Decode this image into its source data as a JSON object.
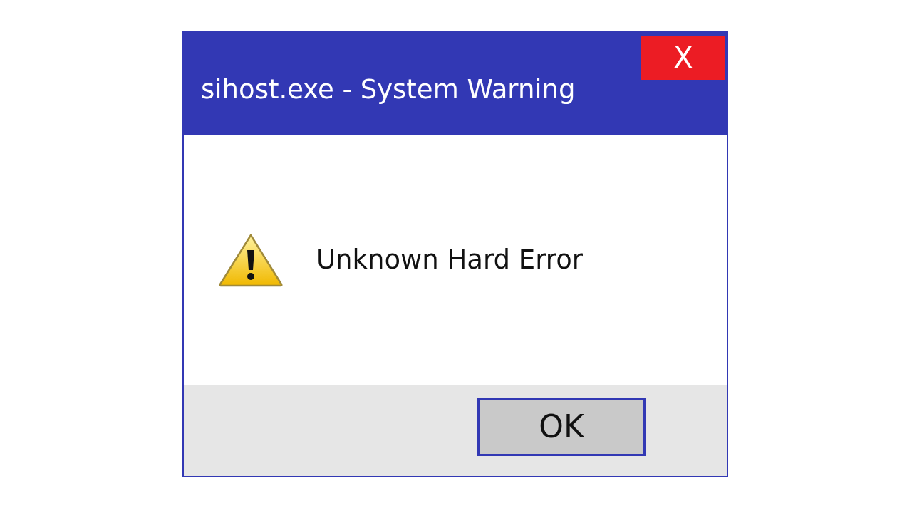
{
  "window": {
    "title": "sihost.exe - System Warning",
    "close_button": "X"
  },
  "message": "Unknown Hard Error",
  "buttons": [
    "OK"
  ]
}
